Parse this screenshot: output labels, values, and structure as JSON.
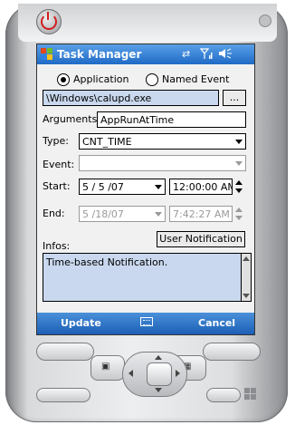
{
  "titlebar": {
    "title": "Task Manager",
    "icons": [
      "windows-flag-icon",
      "sync-icon",
      "signal-icon",
      "speaker-icon"
    ],
    "flag_colors": [
      "#e2461a",
      "#6fbd2b",
      "#2f7fe0",
      "#f7c21b"
    ]
  },
  "form": {
    "radio_application": "Application",
    "radio_named_event": "Named Event",
    "radio_selected": "Application",
    "path_value": "\\Windows\\calupd.exe",
    "browse_label": "...",
    "arguments_label": "Arguments:",
    "arguments_value": "AppRunAtTime",
    "type_label": "Type:",
    "type_value": "CNT_TIME",
    "event_label": "Event:",
    "event_value": "",
    "start_label": "Start:",
    "start_date": "5 / 5 /07",
    "start_time": "12:00:00 AM",
    "end_label": "End:",
    "end_date": "5 /18/07",
    "end_time": "7:42:27 AM",
    "user_notification_label": "User Notification",
    "infos_label": "Infos:",
    "infos_value": "Time-based Notification."
  },
  "menubar": {
    "left_softkey": "Update",
    "right_softkey": "Cancel",
    "center_icon": "keyboard-icon"
  },
  "colors": {
    "titlebar": "#1f6ac6",
    "highlight_field": "#c9d8ee",
    "power_led": "#d21e1e"
  }
}
